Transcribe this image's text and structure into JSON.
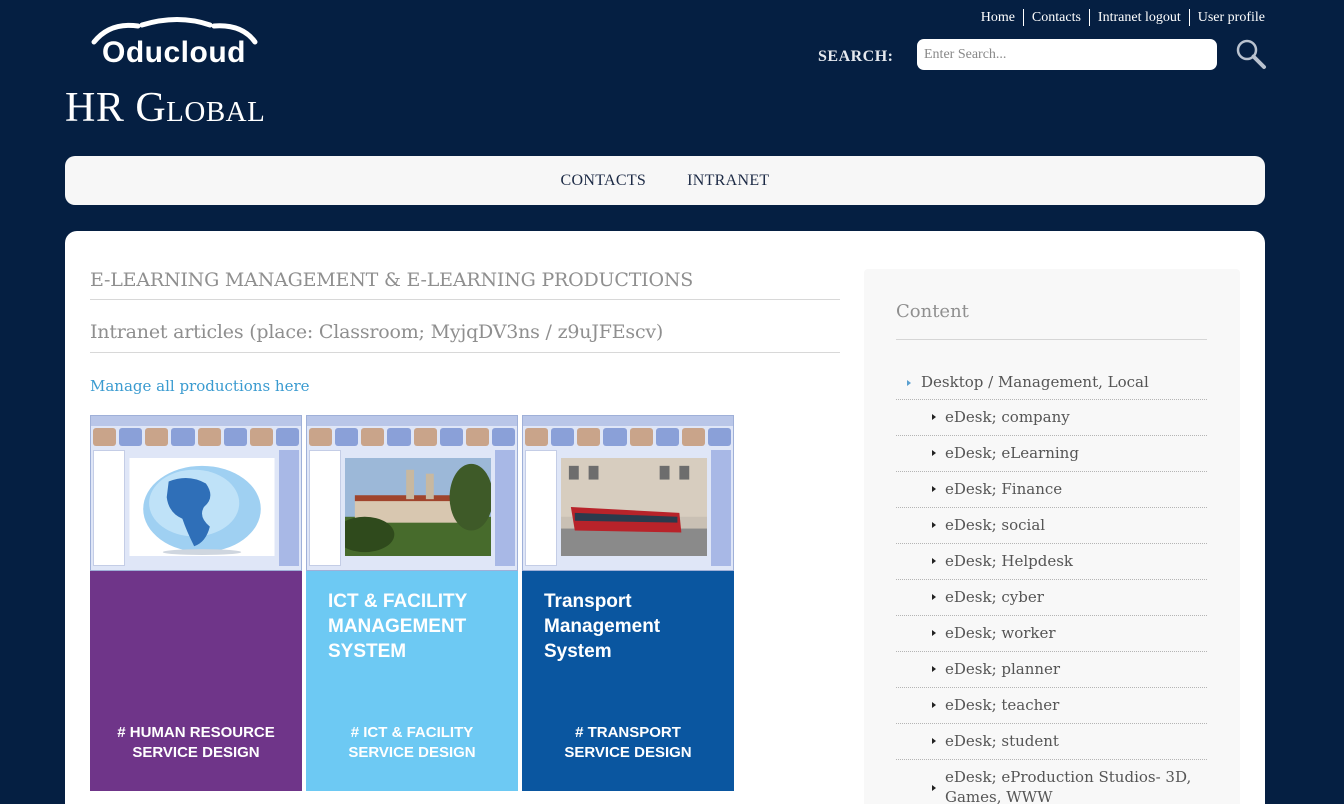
{
  "logo": {
    "text": "Oducloud"
  },
  "site_title": "HR Global",
  "top_links": [
    "Home",
    "Contacts",
    "Intranet logout",
    "User profile"
  ],
  "search": {
    "label": "SEARCH:",
    "placeholder": "Enter Search..."
  },
  "nav": [
    "CONTACTS",
    "INTRANET"
  ],
  "main": {
    "heading": "E-LEARNING MANAGEMENT & E-LEARNING PRODUCTIONS",
    "subheading": "Intranet articles (place: Classroom; MyjqDV3ns / z9uJFEscv)",
    "manage_link": "Manage all productions here",
    "tiles": [
      {
        "title": "",
        "footer_line1": "# HUMAN RESOURCE",
        "footer_line2": "SERVICE DESIGN",
        "color": "#6f3589",
        "photo": "globe"
      },
      {
        "title": "ICT & FACILITY MANAGEMENT SYSTEM",
        "footer_line1": "# ICT & FACILITY",
        "footer_line2": "SERVICE DESIGN",
        "color": "#6dc9f3",
        "photo": "castle"
      },
      {
        "title": "Transport Management System",
        "footer_line1": "# TRANSPORT",
        "footer_line2": "SERVICE DESIGN",
        "color": "#0a56a0",
        "photo": "tram"
      }
    ]
  },
  "sidebar": {
    "title": "Content",
    "parent": "Desktop / Management, Local",
    "items": [
      "eDesk; company",
      "eDesk; eLearning",
      "eDesk; Finance",
      "eDesk; social",
      "eDesk; Helpdesk",
      "eDesk; cyber",
      "eDesk; worker",
      "eDesk; planner",
      "eDesk; teacher",
      "eDesk; student",
      "eDesk; eProduction Studios- 3D, Games, WWW"
    ]
  }
}
